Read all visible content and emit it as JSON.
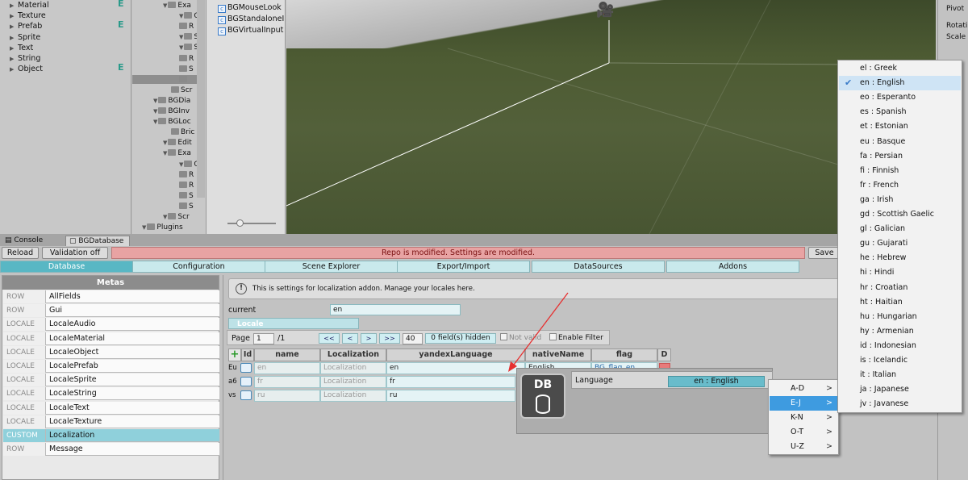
{
  "project_tree": [
    {
      "label": "Material",
      "e": true
    },
    {
      "label": "Texture",
      "e": false
    },
    {
      "label": "Prefab",
      "e": true
    },
    {
      "label": "Sprite",
      "e": false
    },
    {
      "label": "Text",
      "e": false
    },
    {
      "label": "String",
      "e": false
    },
    {
      "label": "Object",
      "e": true
    }
  ],
  "e_marker": "E",
  "hierarchy": {
    "rows": [
      "Exa",
      "C",
      "R",
      "S",
      "S",
      "R",
      "S",
      "",
      "Scr",
      "BGDia",
      "BGInv",
      "BGLoc",
      "Bric",
      "Edit",
      "Exa",
      "C",
      "R",
      "R",
      "S",
      "S",
      "Scr",
      "Plugins"
    ]
  },
  "files": [
    "BGMouseLook",
    "BGStandaloneI",
    "BGVirtualInput"
  ],
  "inspector": {
    "pivot": "Pivot",
    "rotation": "Rotati",
    "scale": "Scale"
  },
  "window_tabs": {
    "console": "Console",
    "bgdatabase": "BGDatabase"
  },
  "toolbar": {
    "reload": "Reload",
    "validation": "Validation off",
    "warning": "Repo is modified. Settings are modified.",
    "save": "Save"
  },
  "main_tabs": [
    "Database",
    "Configuration",
    "Scene Explorer",
    "Export/Import",
    "DataSources",
    "Addons"
  ],
  "metas": {
    "header": "Metas",
    "rows": [
      {
        "type": "ROW",
        "name": "AllFields"
      },
      {
        "type": "ROW",
        "name": "Gui"
      },
      {
        "type": "LOCALE",
        "name": "LocaleAudio"
      },
      {
        "type": "LOCALE",
        "name": "LocaleMaterial"
      },
      {
        "type": "LOCALE",
        "name": "LocaleObject"
      },
      {
        "type": "LOCALE",
        "name": "LocalePrefab"
      },
      {
        "type": "LOCALE",
        "name": "LocaleSprite"
      },
      {
        "type": "LOCALE",
        "name": "LocaleString"
      },
      {
        "type": "LOCALE",
        "name": "LocaleText"
      },
      {
        "type": "LOCALE",
        "name": "LocaleTexture"
      },
      {
        "type": "CUSTOM",
        "name": "Localization"
      },
      {
        "type": "ROW",
        "name": "Message"
      }
    ]
  },
  "info": "This is settings for localization addon. Manage your locales here.",
  "current": {
    "label": "current",
    "value": "en"
  },
  "locale_tab": "Locale",
  "pager": {
    "page_label": "Page",
    "page": "1",
    "of": "/1",
    "first": "<<",
    "prev": "<",
    "next": ">",
    "last": ">>",
    "per_page": "40",
    "hidden": "0 field(s) hidden",
    "not_valid": "Not valid",
    "enable_filter": "Enable Filter"
  },
  "table": {
    "headers": [
      "Id",
      "name",
      "Localization",
      "yandexLanguage",
      "nativeName",
      "flag",
      "D"
    ],
    "rows": [
      {
        "id": "Eu",
        "name": "en",
        "loc": "Localization",
        "yandex": "en",
        "native": "English",
        "flag": "BG_flag_en"
      },
      {
        "id": "a6",
        "name": "fr",
        "loc": "Localization",
        "yandex": "fr",
        "native": "",
        "flag": ""
      },
      {
        "id": "vs",
        "name": "ru",
        "loc": "Localization",
        "yandex": "ru",
        "native": "",
        "flag": ""
      }
    ]
  },
  "popup": {
    "db_text": "DB",
    "language_label": "Language",
    "language_value": "en : English"
  },
  "submenu": [
    "A-D",
    "E-J",
    "K-N",
    "O-T",
    "U-Z"
  ],
  "submenu_selected": "E-J",
  "chevron": ">",
  "languages": [
    "el : Greek",
    "en : English",
    "eo : Esperanto",
    "es : Spanish",
    "et : Estonian",
    "eu : Basque",
    "fa : Persian",
    "fi : Finnish",
    "fr : French",
    "ga : Irish",
    "gd : Scottish Gaelic",
    "gl : Galician",
    "gu : Gujarati",
    "he : Hebrew",
    "hi : Hindi",
    "hr : Croatian",
    "ht : Haitian",
    "hu : Hungarian",
    "hy : Armenian",
    "id : Indonesian",
    "is : Icelandic",
    "it : Italian",
    "ja : Japanese",
    "jv : Javanese"
  ],
  "language_checked": "en : English",
  "colors": {
    "accent": "#58b7c4",
    "warning": "#e8a3a3",
    "menu_highlight": "#3e9be0"
  }
}
